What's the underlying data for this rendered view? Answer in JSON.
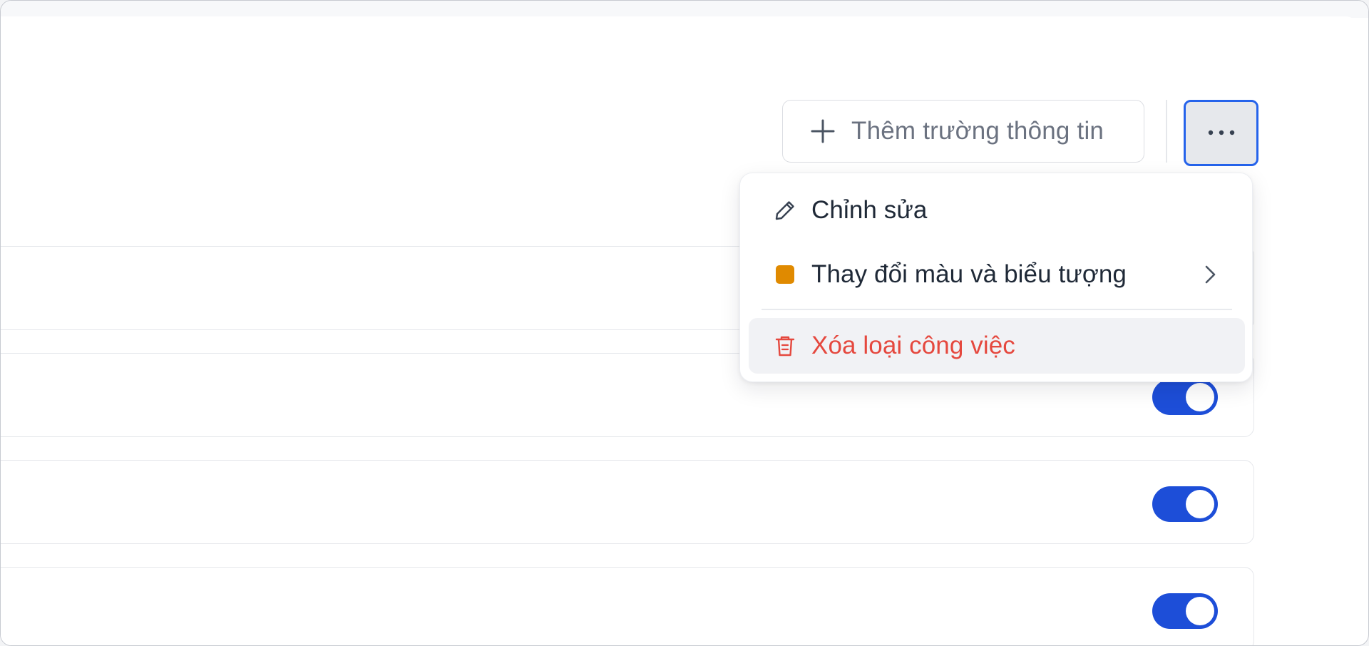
{
  "toolbar": {
    "add_field_label": "Thêm trường thông tin",
    "add_field_icon": "plus-icon",
    "more_icon": "more-horizontal-icon"
  },
  "menu": {
    "items": [
      {
        "label": "Chỉnh sửa",
        "icon": "pencil-icon"
      },
      {
        "label": "Thay đổi màu và biểu tượng",
        "icon": "color-swatch",
        "swatch_color": "#e08a00",
        "has_submenu": true
      },
      {
        "label": "Xóa loại công việc",
        "icon": "trash-icon",
        "destructive": true,
        "color": "#e5483e"
      }
    ]
  },
  "rows": [
    {
      "toggle": null
    },
    {
      "toggle": true
    },
    {
      "toggle": true
    },
    {
      "toggle": true
    }
  ],
  "colors": {
    "accent": "#1d4ed8",
    "focus_ring": "#2563eb",
    "danger": "#e5483e"
  }
}
